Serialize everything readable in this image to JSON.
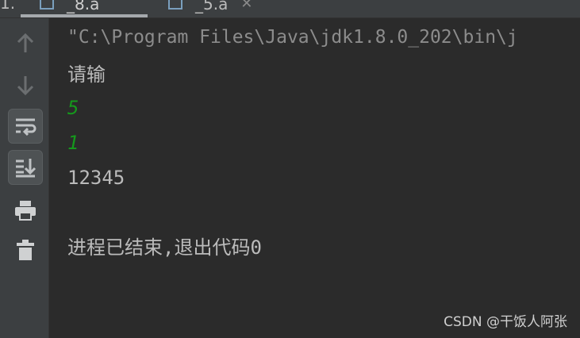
{
  "tabs": [
    {
      "label": "_8.a",
      "active": true
    },
    {
      "label": "_5.a",
      "active": false
    }
  ],
  "tab_edge_text": "1.",
  "gutter": {
    "buttons": [
      {
        "name": "up-arrow-icon"
      },
      {
        "name": "down-arrow-icon"
      },
      {
        "name": "soft-wrap-icon",
        "toggled": true
      },
      {
        "name": "scroll-to-end-icon",
        "toggled": true
      },
      {
        "name": "print-icon"
      },
      {
        "name": "trash-icon"
      }
    ]
  },
  "console": {
    "command": "\"C:\\Program Files\\Java\\jdk1.8.0_202\\bin\\j",
    "prompt": "请输",
    "input1": "5",
    "input2": "1",
    "output": "12345",
    "exit_message": "进程已结束,退出代码0"
  },
  "colors": {
    "background": "#2b2b2b",
    "gutter": "#3c3f41",
    "text": "#bbbbbb",
    "user_input": "#15981c"
  },
  "watermark": "CSDN @干饭人阿张"
}
